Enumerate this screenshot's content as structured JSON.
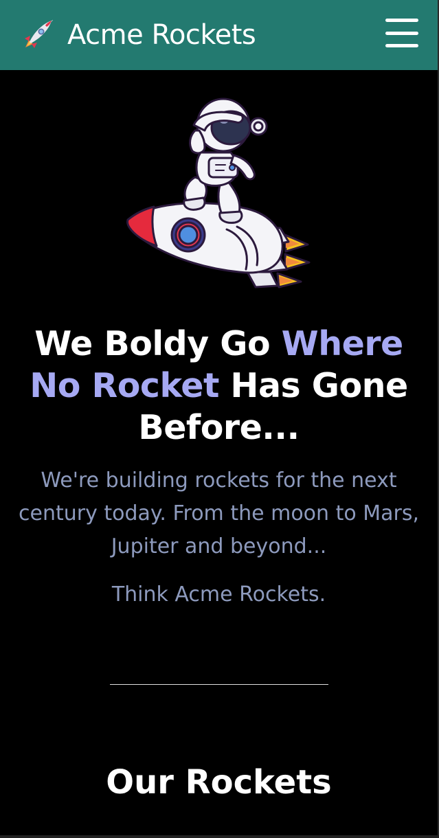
{
  "navbar": {
    "brand_icon": "rocket-icon",
    "brand_name": "Acme Rockets",
    "menu_icon": "hamburger-menu-icon",
    "background_color": "#237a70"
  },
  "hero": {
    "illustration": "astronaut-riding-rocket",
    "heading_part1": "We Boldy Go ",
    "heading_accent": "Where No Rocket",
    "heading_part2": " Has Gone Before...",
    "accent_color": "#a6a9f3",
    "description": "We're building rockets for the next century today. From the moon to Mars, Jupiter and beyond...",
    "tagline": "Think Acme Rockets."
  },
  "rockets_section": {
    "heading": "Our Rockets"
  }
}
